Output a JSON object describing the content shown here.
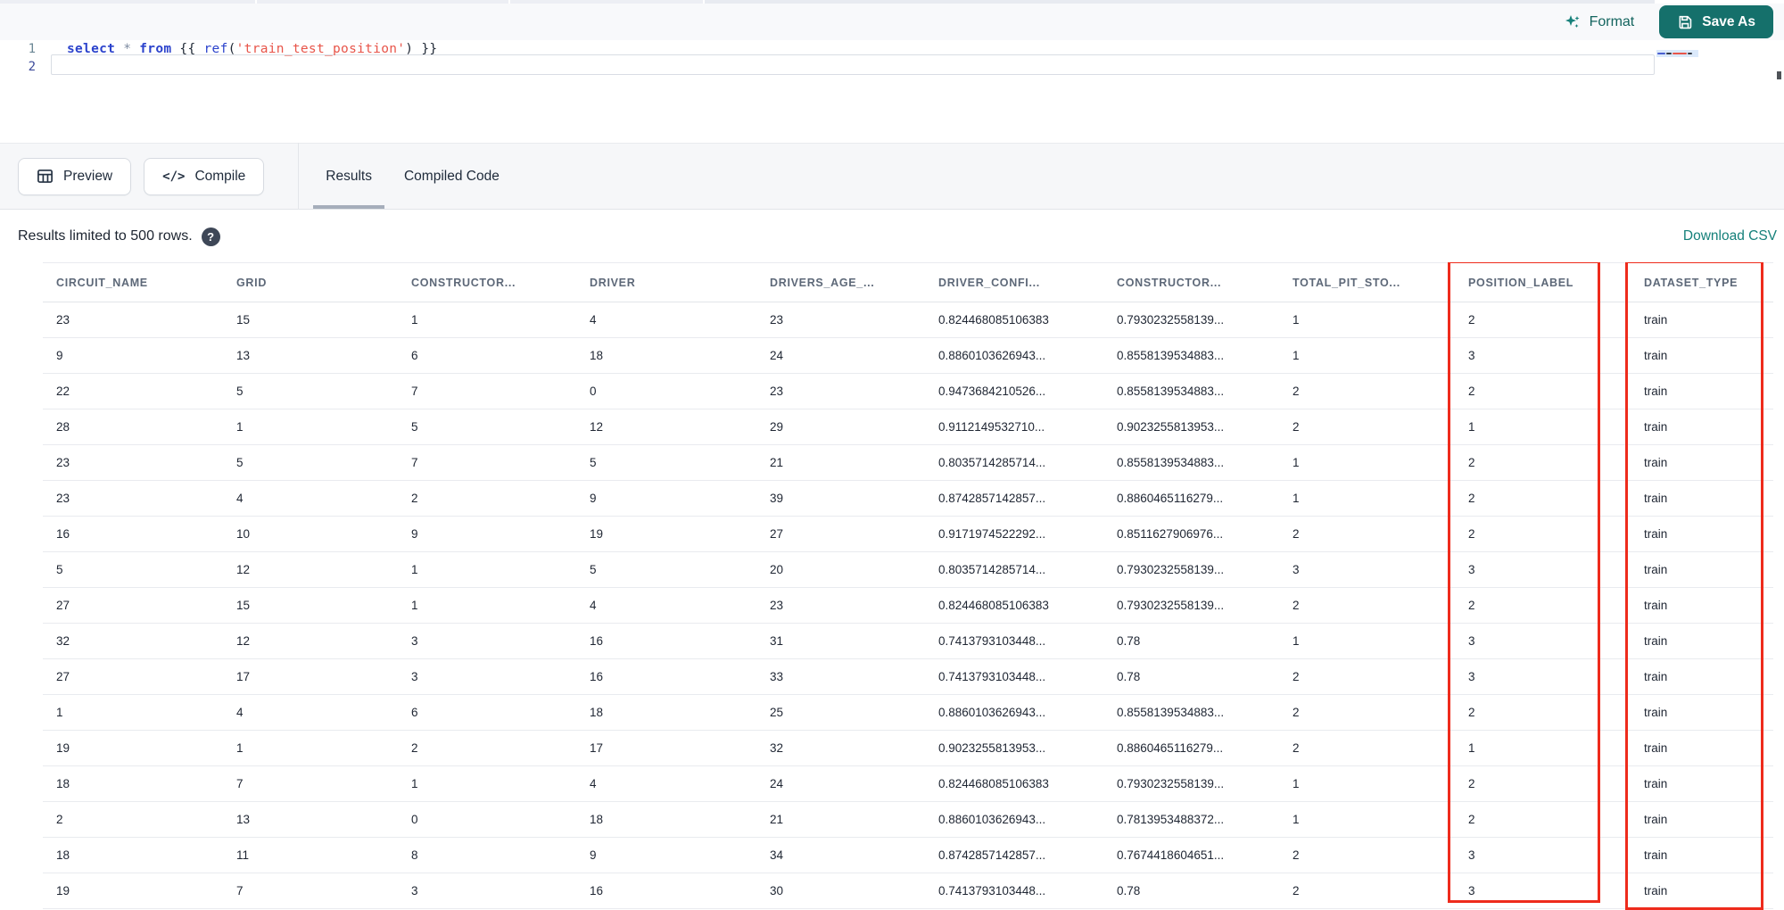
{
  "editor": {
    "format_label": "Format",
    "save_as_label": "Save As",
    "line_numbers": [
      "1",
      "2"
    ],
    "code_tokens": [
      {
        "text": "select",
        "type": "keyword"
      },
      {
        "text": " ",
        "type": "plain"
      },
      {
        "text": "*",
        "type": "operator"
      },
      {
        "text": " ",
        "type": "plain"
      },
      {
        "text": "from",
        "type": "keyword"
      },
      {
        "text": " {{ ",
        "type": "plain"
      },
      {
        "text": "ref",
        "type": "function"
      },
      {
        "text": "(",
        "type": "plain"
      },
      {
        "text": "'train_test_position'",
        "type": "string"
      },
      {
        "text": ")",
        "type": "plain"
      },
      {
        "text": " }}",
        "type": "plain"
      }
    ]
  },
  "toolbar": {
    "preview_label": "Preview",
    "compile_label": "Compile",
    "compile_glyph": "</>",
    "tabs": [
      {
        "label": "Results",
        "active": true
      },
      {
        "label": "Compiled Code",
        "active": false
      }
    ]
  },
  "results_bar": {
    "limit_text": "Results limited to 500 rows.",
    "help_glyph": "?",
    "download_label": "Download CSV"
  },
  "table": {
    "columns": [
      "CIRCUIT_NAME",
      "GRID",
      "CONSTRUCTOR...",
      "DRIVER",
      "DRIVERS_AGE_...",
      "DRIVER_CONFI...",
      "CONSTRUCTOR...",
      "TOTAL_PIT_STO...",
      "POSITION_LABEL",
      "DATASET_TYPE"
    ],
    "rows": [
      [
        "23",
        "15",
        "1",
        "4",
        "23",
        "0.824468085106383",
        "0.7930232558139...",
        "1",
        "2",
        "train"
      ],
      [
        "9",
        "13",
        "6",
        "18",
        "24",
        "0.8860103626943...",
        "0.8558139534883...",
        "1",
        "3",
        "train"
      ],
      [
        "22",
        "5",
        "7",
        "0",
        "23",
        "0.9473684210526...",
        "0.8558139534883...",
        "2",
        "2",
        "train"
      ],
      [
        "28",
        "1",
        "5",
        "12",
        "29",
        "0.9112149532710...",
        "0.9023255813953...",
        "2",
        "1",
        "train"
      ],
      [
        "23",
        "5",
        "7",
        "5",
        "21",
        "0.8035714285714...",
        "0.8558139534883...",
        "1",
        "2",
        "train"
      ],
      [
        "23",
        "4",
        "2",
        "9",
        "39",
        "0.8742857142857...",
        "0.8860465116279...",
        "1",
        "2",
        "train"
      ],
      [
        "16",
        "10",
        "9",
        "19",
        "27",
        "0.9171974522292...",
        "0.8511627906976...",
        "2",
        "2",
        "train"
      ],
      [
        "5",
        "12",
        "1",
        "5",
        "20",
        "0.8035714285714...",
        "0.7930232558139...",
        "3",
        "3",
        "train"
      ],
      [
        "27",
        "15",
        "1",
        "4",
        "23",
        "0.824468085106383",
        "0.7930232558139...",
        "2",
        "2",
        "train"
      ],
      [
        "32",
        "12",
        "3",
        "16",
        "31",
        "0.7413793103448...",
        "0.78",
        "1",
        "3",
        "train"
      ],
      [
        "27",
        "17",
        "3",
        "16",
        "33",
        "0.7413793103448...",
        "0.78",
        "2",
        "3",
        "train"
      ],
      [
        "1",
        "4",
        "6",
        "18",
        "25",
        "0.8860103626943...",
        "0.8558139534883...",
        "2",
        "2",
        "train"
      ],
      [
        "19",
        "1",
        "2",
        "17",
        "32",
        "0.9023255813953...",
        "0.8860465116279...",
        "2",
        "1",
        "train"
      ],
      [
        "18",
        "7",
        "1",
        "4",
        "24",
        "0.824468085106383",
        "0.7930232558139...",
        "1",
        "2",
        "train"
      ],
      [
        "2",
        "13",
        "0",
        "18",
        "21",
        "0.8860103626943...",
        "0.7813953488372...",
        "1",
        "2",
        "train"
      ],
      [
        "18",
        "11",
        "8",
        "9",
        "34",
        "0.8742857142857...",
        "0.7674418604651...",
        "2",
        "3",
        "train"
      ],
      [
        "19",
        "7",
        "3",
        "16",
        "30",
        "0.7413793103448...",
        "0.78",
        "2",
        "3",
        "train"
      ]
    ],
    "annotated_columns": [
      "POSITION_LABEL",
      "DATASET_TYPE"
    ]
  },
  "colors": {
    "accent_teal": "#15706b",
    "link_teal": "#15807a",
    "annotation_red": "#ee2b1c",
    "keyword_blue": "#2c43cc",
    "string_red": "#e8554a"
  }
}
